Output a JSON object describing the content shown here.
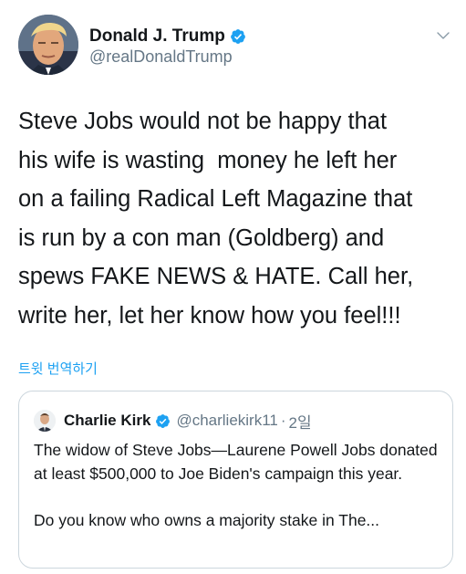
{
  "tweet": {
    "author": {
      "display_name": "Donald J. Trump",
      "handle": "@realDonaldTrump",
      "verified": true
    },
    "text": "Steve Jobs would not be happy that\nhis wife is wasting  money he left her\non a failing Radical Left Magazine that\nis run by a con man (Goldberg) and\nspews FAKE NEWS & HATE. Call her,\nwrite her, let her know how you feel!!!",
    "translate_label": "트윗 번역하기"
  },
  "quoted_tweet": {
    "author": {
      "display_name": "Charlie Kirk",
      "handle": "@charliekirk11",
      "verified": true
    },
    "separator": "·",
    "time": "2일",
    "paragraph1": "The widow of Steve Jobs—Laurene Powell Jobs donated at least $500,000 to Joe Biden's campaign this year.",
    "paragraph2": "Do you know who owns a majority stake in The..."
  },
  "icons": {
    "verified": "verified-badge-icon",
    "caret": "chevron-down-icon"
  },
  "colors": {
    "accent": "#1da1f2",
    "text": "#14171a",
    "secondary": "#657786",
    "border": "#ccd6dd"
  }
}
